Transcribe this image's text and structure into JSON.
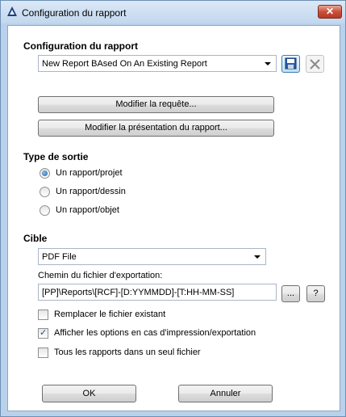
{
  "window": {
    "title": "Configuration du rapport",
    "close_label": "✕"
  },
  "report_config": {
    "section_label": "Configuration du rapport",
    "selected_report": "New Report BAsed On An Existing Report"
  },
  "actions": {
    "modify_query": "Modifier la requête...",
    "modify_presentation": "Modifier la présentation du rapport..."
  },
  "output_type": {
    "section_label": "Type de sortie",
    "options": [
      {
        "label": "Un rapport/projet",
        "checked": true
      },
      {
        "label": "Un rapport/dessin",
        "checked": false
      },
      {
        "label": "Un rapport/objet",
        "checked": false
      }
    ]
  },
  "target": {
    "section_label": "Cible",
    "selected_format": "PDF File",
    "path_label": "Chemin du fichier d'exportation:",
    "path_value": "[PP]\\Reports\\[RCF]-[D:YYMMDD]-[T:HH-MM-SS]",
    "browse_label": "...",
    "help_label": "?",
    "checkboxes": [
      {
        "label": "Remplacer le fichier existant",
        "checked": false
      },
      {
        "label": "Afficher les options en cas d'impression/exportation",
        "checked": true
      },
      {
        "label": "Tous les rapports dans un seul fichier",
        "checked": false
      }
    ]
  },
  "footer": {
    "ok_label": "OK",
    "cancel_label": "Annuler"
  }
}
